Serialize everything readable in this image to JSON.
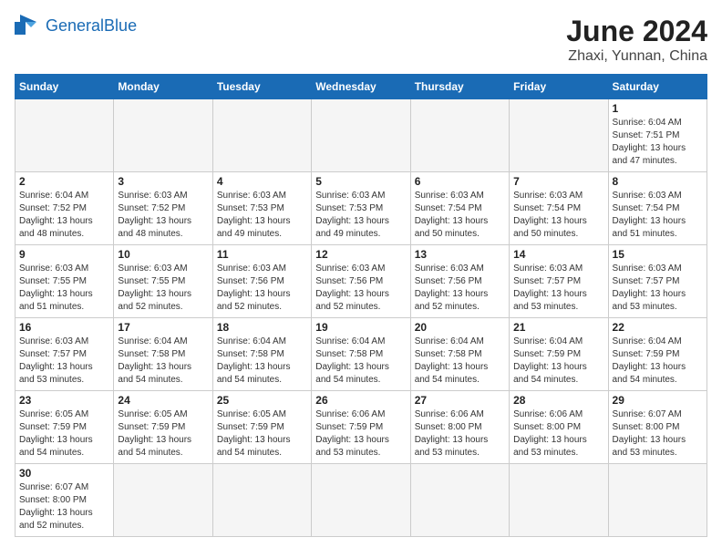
{
  "header": {
    "logo_general": "General",
    "logo_blue": "Blue",
    "title": "June 2024",
    "subtitle": "Zhaxi, Yunnan, China"
  },
  "weekdays": [
    "Sunday",
    "Monday",
    "Tuesday",
    "Wednesday",
    "Thursday",
    "Friday",
    "Saturday"
  ],
  "days": [
    {
      "date": 1,
      "sunrise": "6:04 AM",
      "sunset": "7:51 PM",
      "daylight": "13 hours and 47 minutes."
    },
    {
      "date": 2,
      "sunrise": "6:04 AM",
      "sunset": "7:52 PM",
      "daylight": "13 hours and 48 minutes."
    },
    {
      "date": 3,
      "sunrise": "6:03 AM",
      "sunset": "7:52 PM",
      "daylight": "13 hours and 48 minutes."
    },
    {
      "date": 4,
      "sunrise": "6:03 AM",
      "sunset": "7:53 PM",
      "daylight": "13 hours and 49 minutes."
    },
    {
      "date": 5,
      "sunrise": "6:03 AM",
      "sunset": "7:53 PM",
      "daylight": "13 hours and 49 minutes."
    },
    {
      "date": 6,
      "sunrise": "6:03 AM",
      "sunset": "7:54 PM",
      "daylight": "13 hours and 50 minutes."
    },
    {
      "date": 7,
      "sunrise": "6:03 AM",
      "sunset": "7:54 PM",
      "daylight": "13 hours and 50 minutes."
    },
    {
      "date": 8,
      "sunrise": "6:03 AM",
      "sunset": "7:54 PM",
      "daylight": "13 hours and 51 minutes."
    },
    {
      "date": 9,
      "sunrise": "6:03 AM",
      "sunset": "7:55 PM",
      "daylight": "13 hours and 51 minutes."
    },
    {
      "date": 10,
      "sunrise": "6:03 AM",
      "sunset": "7:55 PM",
      "daylight": "13 hours and 52 minutes."
    },
    {
      "date": 11,
      "sunrise": "6:03 AM",
      "sunset": "7:56 PM",
      "daylight": "13 hours and 52 minutes."
    },
    {
      "date": 12,
      "sunrise": "6:03 AM",
      "sunset": "7:56 PM",
      "daylight": "13 hours and 52 minutes."
    },
    {
      "date": 13,
      "sunrise": "6:03 AM",
      "sunset": "7:56 PM",
      "daylight": "13 hours and 52 minutes."
    },
    {
      "date": 14,
      "sunrise": "6:03 AM",
      "sunset": "7:57 PM",
      "daylight": "13 hours and 53 minutes."
    },
    {
      "date": 15,
      "sunrise": "6:03 AM",
      "sunset": "7:57 PM",
      "daylight": "13 hours and 53 minutes."
    },
    {
      "date": 16,
      "sunrise": "6:03 AM",
      "sunset": "7:57 PM",
      "daylight": "13 hours and 53 minutes."
    },
    {
      "date": 17,
      "sunrise": "6:04 AM",
      "sunset": "7:58 PM",
      "daylight": "13 hours and 54 minutes."
    },
    {
      "date": 18,
      "sunrise": "6:04 AM",
      "sunset": "7:58 PM",
      "daylight": "13 hours and 54 minutes."
    },
    {
      "date": 19,
      "sunrise": "6:04 AM",
      "sunset": "7:58 PM",
      "daylight": "13 hours and 54 minutes."
    },
    {
      "date": 20,
      "sunrise": "6:04 AM",
      "sunset": "7:58 PM",
      "daylight": "13 hours and 54 minutes."
    },
    {
      "date": 21,
      "sunrise": "6:04 AM",
      "sunset": "7:59 PM",
      "daylight": "13 hours and 54 minutes."
    },
    {
      "date": 22,
      "sunrise": "6:04 AM",
      "sunset": "7:59 PM",
      "daylight": "13 hours and 54 minutes."
    },
    {
      "date": 23,
      "sunrise": "6:05 AM",
      "sunset": "7:59 PM",
      "daylight": "13 hours and 54 minutes."
    },
    {
      "date": 24,
      "sunrise": "6:05 AM",
      "sunset": "7:59 PM",
      "daylight": "13 hours and 54 minutes."
    },
    {
      "date": 25,
      "sunrise": "6:05 AM",
      "sunset": "7:59 PM",
      "daylight": "13 hours and 54 minutes."
    },
    {
      "date": 26,
      "sunrise": "6:06 AM",
      "sunset": "7:59 PM",
      "daylight": "13 hours and 53 minutes."
    },
    {
      "date": 27,
      "sunrise": "6:06 AM",
      "sunset": "8:00 PM",
      "daylight": "13 hours and 53 minutes."
    },
    {
      "date": 28,
      "sunrise": "6:06 AM",
      "sunset": "8:00 PM",
      "daylight": "13 hours and 53 minutes."
    },
    {
      "date": 29,
      "sunrise": "6:07 AM",
      "sunset": "8:00 PM",
      "daylight": "13 hours and 53 minutes."
    },
    {
      "date": 30,
      "sunrise": "6:07 AM",
      "sunset": "8:00 PM",
      "daylight": "13 hours and 52 minutes."
    }
  ]
}
